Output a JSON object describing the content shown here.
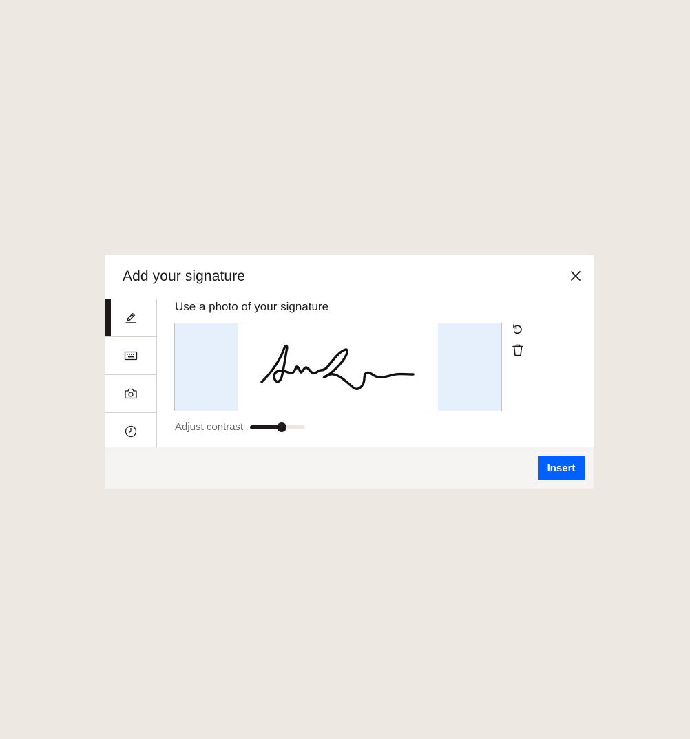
{
  "dialog": {
    "title": "Add your signature",
    "close_icon": "close-icon"
  },
  "tabs": [
    {
      "icon": "pen-draw-icon",
      "active": true
    },
    {
      "icon": "keyboard-icon",
      "active": false
    },
    {
      "icon": "camera-icon",
      "active": false
    },
    {
      "icon": "clock-icon",
      "active": false
    }
  ],
  "panel": {
    "title": "Use a photo of your signature",
    "tools": [
      "undo-icon",
      "trash-icon"
    ],
    "contrast": {
      "label": "Adjust contrast",
      "value": 0.57
    }
  },
  "footer": {
    "insert_label": "Insert"
  },
  "colors": {
    "background": "#EEE8E2",
    "dialog": "#FFFFFF",
    "footer": "#F6F4F2",
    "accent": "#0061FE",
    "crop_overlay": "#E6EFFC",
    "text": "#1E1919",
    "muted_text": "#6D6762"
  }
}
